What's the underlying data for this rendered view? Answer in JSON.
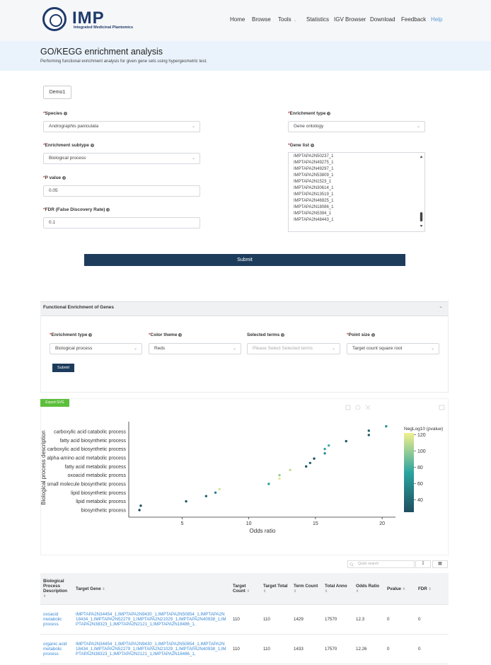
{
  "header": {
    "logo_text": "IMP",
    "logo_subtitle": "Integrated Medicinal Plantomics",
    "nav": [
      "Home",
      "Browse",
      "Tools",
      "Statistics",
      "IGV Browser",
      "Download",
      "Feedback",
      "Help"
    ]
  },
  "page": {
    "title": "GO/KEGG enrichment analysis",
    "subtitle": "Performing functional enrichment analysis for given gene sets using hypergeometric test."
  },
  "form": {
    "demo_label": "Demo1",
    "species_label": "Species",
    "species_value": "Andrographis paniculata",
    "enrich_type_label": "Enrichment type",
    "enrich_type_value": "Gene ontology",
    "enrich_subtype_label": "Enrichment subtype",
    "enrich_subtype_value": "Biological process",
    "gene_list_label": "Gene list",
    "gene_list": [
      "IMPTAPA2N50237_1",
      "IMPTAPA2N49275_1",
      "IMPTAPA2N49297_1",
      "IMPTAPA2N53809_1",
      "IMPTAPA2N1523_1",
      "IMPTAPA2N30614_1",
      "IMPTAPA2N13519_1",
      "IMPTAPA2N46925_1",
      "IMPTAPA2N18086_1",
      "IMPTAPA2N5394_1",
      "IMPTAPA2N48443_1"
    ],
    "pvalue_label": "P value",
    "pvalue_value": "0.05",
    "fdr_label": "FDR (False Discovery Rate)",
    "fdr_value": "0.1",
    "submit_label": "Submit"
  },
  "panel": {
    "title": "Functional Enrichment of Genes",
    "enrich_type_label": "Enrichment type",
    "enrich_type_value": "Biological process",
    "color_theme_label": "Color theme",
    "color_theme_value": "Reds",
    "selected_terms_label": "Selected terms",
    "selected_terms_placeholder": "Please Select Selected terms",
    "point_size_label": "Point size",
    "point_size_value": "Target count square root",
    "submit_label": "Submit",
    "export_label": "Export SVG"
  },
  "chart_data": {
    "type": "scatter",
    "xlabel": "Odds ratio",
    "ylabel": "Biological process description",
    "categories": [
      "biosynthetic process",
      "lipid metabolic process",
      "lipid biosynthetic process",
      "small molecule biosynthetic process",
      "oxoacid metabolic process",
      "fatty acid metabolic process",
      "alpha-amino acid metabolic process",
      "carboxylic acid biosynthetic process",
      "fatty acid biosynthetic process",
      "carboxylic acid catabolic process"
    ],
    "xticks": [
      5,
      10,
      15,
      20
    ],
    "xlim": [
      1,
      21
    ],
    "colorbar_label": "NegLog10 (pvalue)",
    "colorbar_ticks": [
      40,
      60,
      80,
      100,
      120
    ],
    "colorbar_range": [
      25,
      122
    ],
    "colors": {
      "low": "#1f4e5f",
      "mid": "#2aa4a0",
      "high": "#f2f08c"
    },
    "points": [
      {
        "x": 1.8,
        "y": 0,
        "c": 25
      },
      {
        "x": 1.9,
        "y": 0.5,
        "c": 27
      },
      {
        "x": 5.3,
        "y": 1,
        "c": 28
      },
      {
        "x": 6.8,
        "y": 1.6,
        "c": 35
      },
      {
        "x": 7.5,
        "y": 2,
        "c": 55
      },
      {
        "x": 7.8,
        "y": 2.4,
        "c": 115
      },
      {
        "x": 11.5,
        "y": 3,
        "c": 70
      },
      {
        "x": 12.3,
        "y": 3.6,
        "c": 118
      },
      {
        "x": 12.3,
        "y": 4,
        "c": 100
      },
      {
        "x": 13.1,
        "y": 4.6,
        "c": 110
      },
      {
        "x": 14.3,
        "y": 5,
        "c": 30
      },
      {
        "x": 14.6,
        "y": 5.4,
        "c": 38
      },
      {
        "x": 14.9,
        "y": 5.9,
        "c": 28
      },
      {
        "x": 15.7,
        "y": 6.5,
        "c": 60
      },
      {
        "x": 15.7,
        "y": 7,
        "c": 75
      },
      {
        "x": 16.0,
        "y": 7.4,
        "c": 80
      },
      {
        "x": 17.3,
        "y": 7.9,
        "c": 30
      },
      {
        "x": 19.0,
        "y": 8.6,
        "c": 32
      },
      {
        "x": 19.0,
        "y": 9.1,
        "c": 35
      },
      {
        "x": 20.3,
        "y": 9.6,
        "c": 65
      }
    ]
  },
  "table": {
    "search_placeholder": "Quick search",
    "columns": [
      "Biological Process Description",
      "Target Gene",
      "Target Count",
      "Target Total",
      "Term Count",
      "Total Anno",
      "Odds Ratio",
      "Pvalue",
      "FDR"
    ],
    "rows": [
      {
        "desc": "oxoacid metabolic process",
        "genes": "IMPTAPA2N34454_1,IMPTAPA2N9430_1,IMPTAPA2N50854_1,IMPTAPA2N18434_1,IMPTAPA2N52279_1,IMPTAPA2N21029_1,IMPTAPA2N40938_1,IMPTAPA2N38323_1,IMPTAPA2N2121_1,IMPTAPA2N18486_1,",
        "target_count": "110",
        "target_total": "110",
        "term_count": "1429",
        "total_anno": "17570",
        "odds_ratio": "12.3",
        "pvalue": "0",
        "fdr": "0"
      },
      {
        "desc": "organic acid metabolic process",
        "genes": "IMPTAPA2N34454_1,IMPTAPA2N9430_1,IMPTAPA2N50854_1,IMPTAPA2N18434_1,IMPTAPA2N52279_1,IMPTAPA2N21029_1,IMPTAPA2N40938_1,IMPTAPA2N38323_1,IMPTAPA2N2121_1,IMPTAPA2N18486_1,",
        "target_count": "110",
        "target_total": "110",
        "term_count": "1433",
        "total_anno": "17570",
        "odds_ratio": "12.26",
        "pvalue": "0",
        "fdr": "0"
      }
    ]
  }
}
